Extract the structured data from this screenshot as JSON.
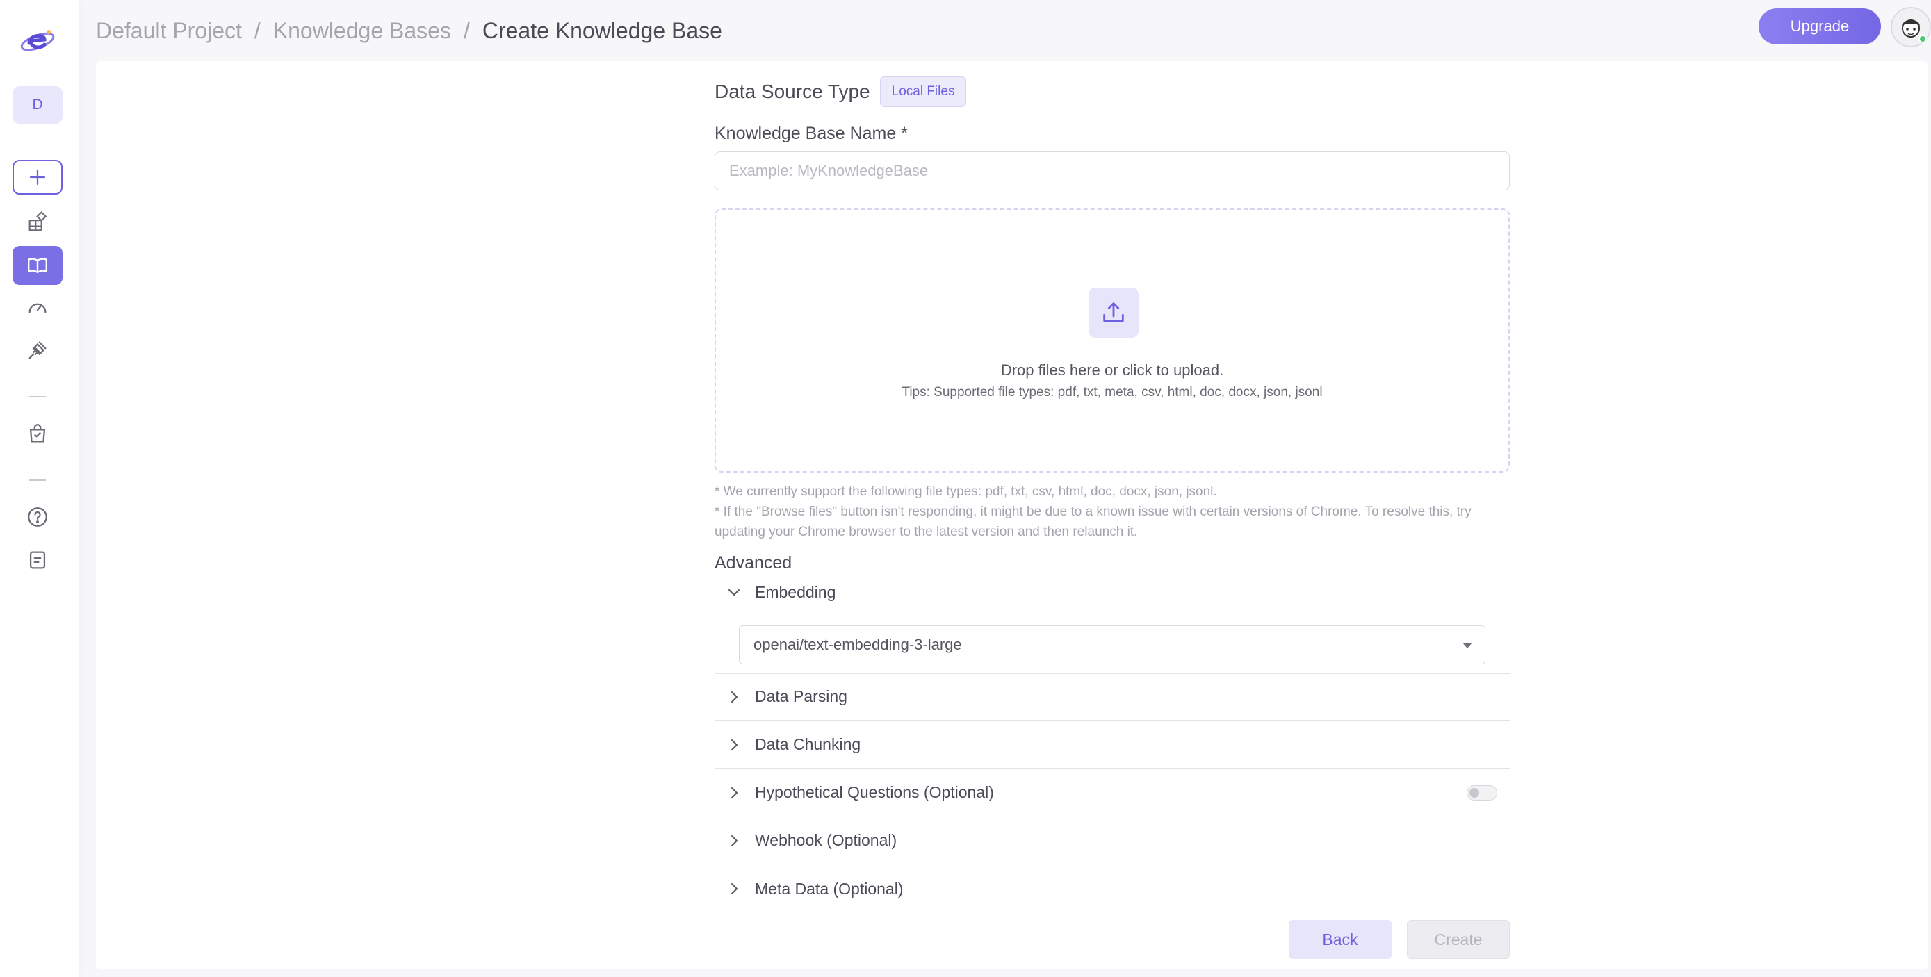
{
  "header": {
    "breadcrumb": [
      "Default Project",
      "Knowledge Bases",
      "Create Knowledge Base"
    ],
    "separator": "/",
    "upgrade_label": "Upgrade"
  },
  "sidebar": {
    "project_initial": "D",
    "items": [
      {
        "icon": "plus-icon",
        "active": false
      },
      {
        "icon": "apps-icon",
        "active": false
      },
      {
        "icon": "book-icon",
        "active": true
      },
      {
        "icon": "gauge-icon",
        "active": false
      },
      {
        "icon": "plug-icon",
        "active": false
      },
      {
        "icon": "bag-icon",
        "active": false
      },
      {
        "icon": "help-icon",
        "active": false
      },
      {
        "icon": "document-icon",
        "active": false
      }
    ]
  },
  "form": {
    "data_source_label": "Data Source Type",
    "data_source_tag": "Local Files",
    "kb_name_label": "Knowledge Base Name *",
    "kb_name_placeholder": "Example: MyKnowledgeBase",
    "kb_name_value": "",
    "upload": {
      "main": "Drop files here or click to upload.",
      "tip": "Tips: Supported file types: pdf, txt, meta, csv, html, doc, docx, json, jsonl"
    },
    "notes": [
      "* We currently support the following file types: pdf, txt, csv, html, doc, docx, json, jsonl.",
      "* If the \"Browse files\" button isn't responding, it might be due to a known issue with certain versions of Chrome. To resolve this, try updating your Chrome browser to the latest version and then relaunch it."
    ],
    "advanced_label": "Advanced",
    "embedding": {
      "title": "Embedding",
      "expanded": true,
      "selected": "openai/text-embedding-3-large"
    },
    "sections": [
      {
        "title": "Data Parsing",
        "toggle": false
      },
      {
        "title": "Data Chunking",
        "toggle": false
      },
      {
        "title": "Hypothetical Questions (Optional)",
        "toggle": true,
        "enabled": false
      },
      {
        "title": "Webhook (Optional)",
        "toggle": false
      },
      {
        "title": "Meta Data (Optional)",
        "toggle": false
      }
    ],
    "back_label": "Back",
    "create_label": "Create"
  },
  "colors": {
    "accent": "#7b6fe6",
    "accent_light": "#e7e5fa",
    "text_muted": "#a5a5af"
  }
}
